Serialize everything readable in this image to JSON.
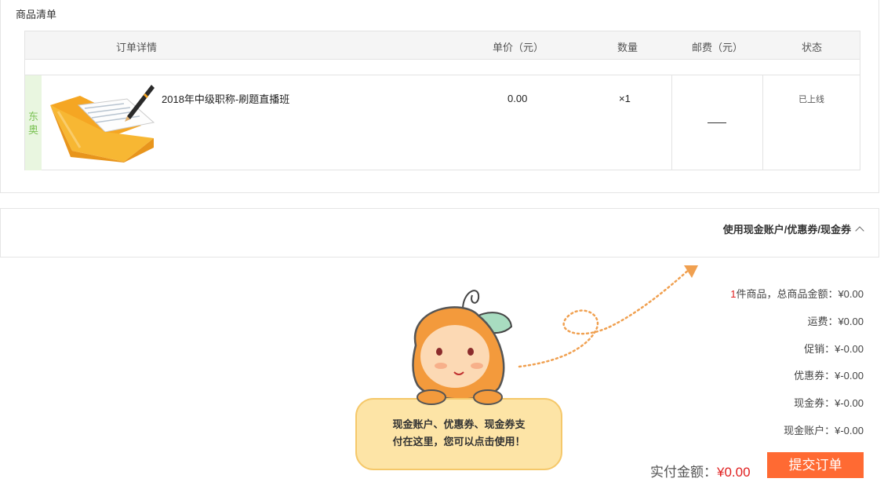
{
  "panel_title": "商品清单",
  "table": {
    "headers": {
      "detail": "订单详情",
      "price": "单价（元）",
      "qty": "数量",
      "shipping": "邮费（元）",
      "status": "状态"
    }
  },
  "item": {
    "shop_tag": "东奥",
    "name": "2018年中级职称-刷题直播班",
    "price": "0.00",
    "qty": "×1",
    "status": "已上线"
  },
  "coupon_toggle_label": "使用现金账户/优惠券/现金券",
  "mascot_bubble": {
    "line1": "现金账户、优惠券、现金券支",
    "line2": "付在这里，您可以点击使用！"
  },
  "summary": {
    "item_count": "1",
    "goods_label": "件商品，总商品金额：",
    "goods_amount": "¥0.00",
    "shipping_label": "运费：",
    "shipping_amount": "¥0.00",
    "promo_label": "促销：",
    "promo_amount": "¥-0.00",
    "coupon_label": "优惠券：",
    "coupon_amount": "¥-0.00",
    "cashcoupon_label": "现金券：",
    "cashcoupon_amount": "¥-0.00",
    "cashaccount_label": "现金账户：",
    "cashaccount_amount": "¥-0.00"
  },
  "total": {
    "label": "实付金额：",
    "amount": "¥0.00"
  },
  "submit_label": "提交订单",
  "colors": {
    "accent": "#ff6a33",
    "price_red": "#e02020",
    "shop_tag_bg": "#e9f6e0",
    "shop_tag_text": "#7cc356"
  }
}
